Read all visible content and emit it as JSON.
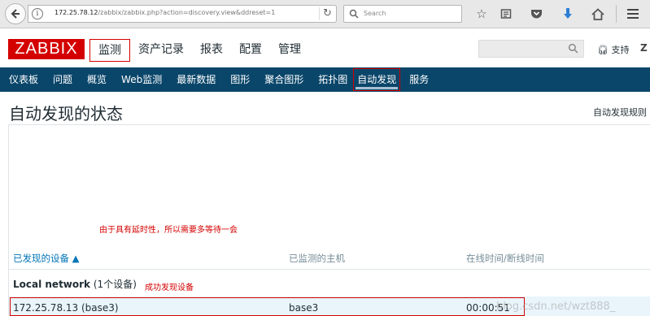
{
  "browser": {
    "url_host": "172.25.78.12",
    "url_path": "/zabbix/zabbix.php?action=discovery.view&ddreset=1",
    "search_placeholder": "Search"
  },
  "header": {
    "logo": "ZABBIX",
    "menu": [
      {
        "label": "监测"
      },
      {
        "label": "资产记录"
      },
      {
        "label": "报表"
      },
      {
        "label": "配置"
      },
      {
        "label": "管理"
      }
    ],
    "support": "支持",
    "z_label": "Z"
  },
  "subnav": [
    {
      "label": "仪表板"
    },
    {
      "label": "问题"
    },
    {
      "label": "概览"
    },
    {
      "label": "Web监测"
    },
    {
      "label": "最新数据"
    },
    {
      "label": "图形"
    },
    {
      "label": "聚合图形"
    },
    {
      "label": "拓扑图"
    },
    {
      "label": "自动发现"
    },
    {
      "label": "服务"
    }
  ],
  "page": {
    "title": "自动发现的状态",
    "right_label": "自动发现规则"
  },
  "annotations": {
    "note1": "由于具有延时性，所以需要多等待一会",
    "note2": "成功发现设备"
  },
  "table": {
    "headers": {
      "device": "已发现的设备 ▲",
      "host": "已监测的主机",
      "uptime": "在线时间/断线时间"
    },
    "group": {
      "name": "Local network",
      "count": "(1个设备)"
    },
    "row": {
      "device": "172.25.78.13 (base3)",
      "host": "base3",
      "uptime": "00:00:51"
    }
  },
  "watermark": "blog.csdn.net/wzt888_"
}
